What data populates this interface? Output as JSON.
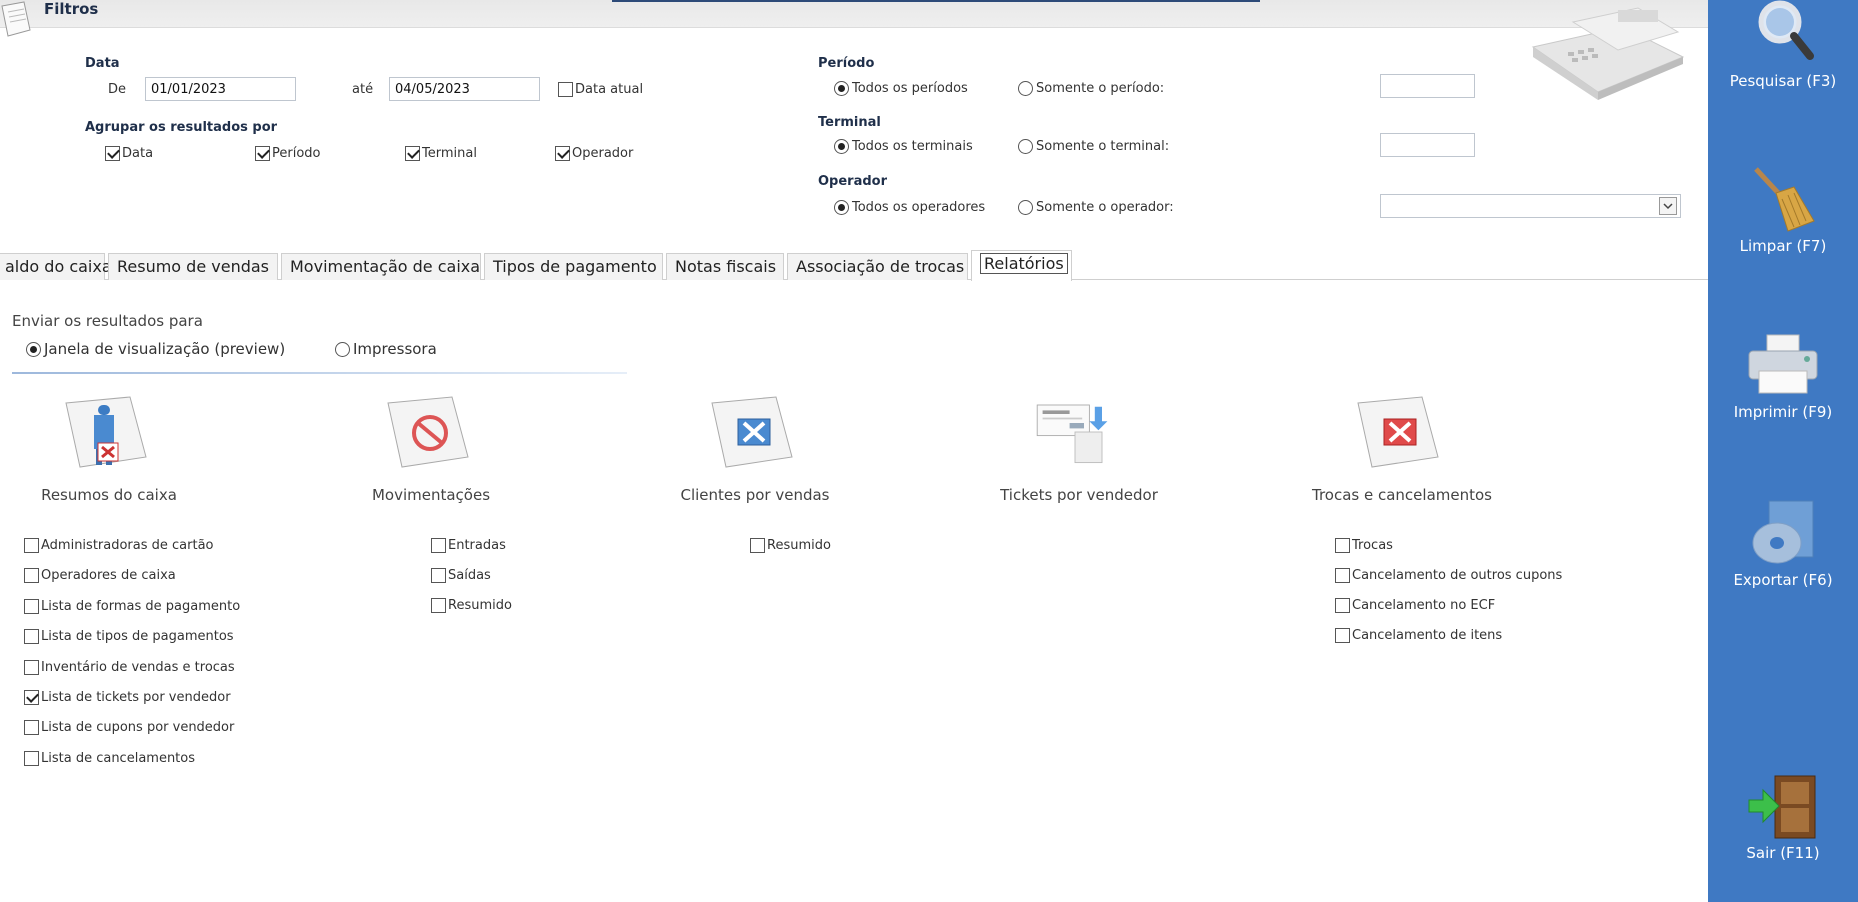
{
  "header": {
    "title": "Filtros"
  },
  "data_section": {
    "label": "Data",
    "from_label": "De",
    "from_value": "01/01/2023",
    "to_label": "até",
    "to_value": "04/05/2023",
    "current_date_label": "Data atual",
    "current_date_checked": false
  },
  "group_by": {
    "label": "Agrupar os resultados por",
    "options": [
      {
        "label": "Data",
        "checked": true
      },
      {
        "label": "Período",
        "checked": true
      },
      {
        "label": "Terminal",
        "checked": true
      },
      {
        "label": "Operador",
        "checked": true
      }
    ]
  },
  "periodo": {
    "label": "Período",
    "all": "Todos os períodos",
    "only": "Somente o período:",
    "selected": "all"
  },
  "terminal": {
    "label": "Terminal",
    "all": "Todos os terminais",
    "only": "Somente o terminal:",
    "selected": "all"
  },
  "operador": {
    "label": "Operador",
    "all": "Todos os operadores",
    "only": "Somente o operador:",
    "selected": "all"
  },
  "tabs": [
    {
      "label": "aldo do caixa",
      "active": false
    },
    {
      "label": "Resumo de vendas",
      "active": false
    },
    {
      "label": "Movimentação de caixa",
      "active": false
    },
    {
      "label": "Tipos de pagamento",
      "active": false
    },
    {
      "label": "Notas fiscais",
      "active": false
    },
    {
      "label": "Associação de trocas",
      "active": false
    },
    {
      "label": "Relatórios",
      "active": true
    }
  ],
  "output": {
    "label": "Enviar os resultados para",
    "preview": "Janela de visualização (preview)",
    "printer": "Impressora",
    "selected": "preview"
  },
  "report_groups": [
    {
      "caption": "Resumos do caixa",
      "items": [
        {
          "label": "Administradoras de cartão",
          "checked": false
        },
        {
          "label": "Operadores de caixa",
          "checked": false
        },
        {
          "label": "Lista de formas de pagamento",
          "checked": false
        },
        {
          "label": "Lista de tipos de pagamentos",
          "checked": false
        },
        {
          "label": "Inventário de vendas e trocas",
          "checked": false
        },
        {
          "label": "Lista de tickets por vendedor",
          "checked": true
        },
        {
          "label": "Lista de cupons por vendedor",
          "checked": false
        },
        {
          "label": "Lista de cancelamentos",
          "checked": false
        }
      ]
    },
    {
      "caption": "Movimentações",
      "items": [
        {
          "label": "Entradas",
          "checked": false
        },
        {
          "label": "Saídas",
          "checked": false
        },
        {
          "label": "Resumido",
          "checked": false
        }
      ]
    },
    {
      "caption": "Clientes por vendas",
      "items": [
        {
          "label": "Resumido",
          "checked": false
        }
      ]
    },
    {
      "caption": "Tickets por vendedor",
      "items": []
    },
    {
      "caption": "Trocas e cancelamentos",
      "items": [
        {
          "label": "Trocas",
          "checked": false
        },
        {
          "label": "Cancelamento de outros cupons",
          "checked": false
        },
        {
          "label": "Cancelamento no ECF",
          "checked": false
        },
        {
          "label": "Cancelamento de itens",
          "checked": false
        }
      ]
    }
  ],
  "sidebar": {
    "search": "Pesquisar (F3)",
    "clear": "Limpar (F7)",
    "print": "Imprimir (F9)",
    "export": "Exportar (F6)",
    "exit": "Sair (F11)"
  },
  "colors": {
    "sidebar_bg": "#3f79c3",
    "label_navy": "#1f2f4a"
  }
}
